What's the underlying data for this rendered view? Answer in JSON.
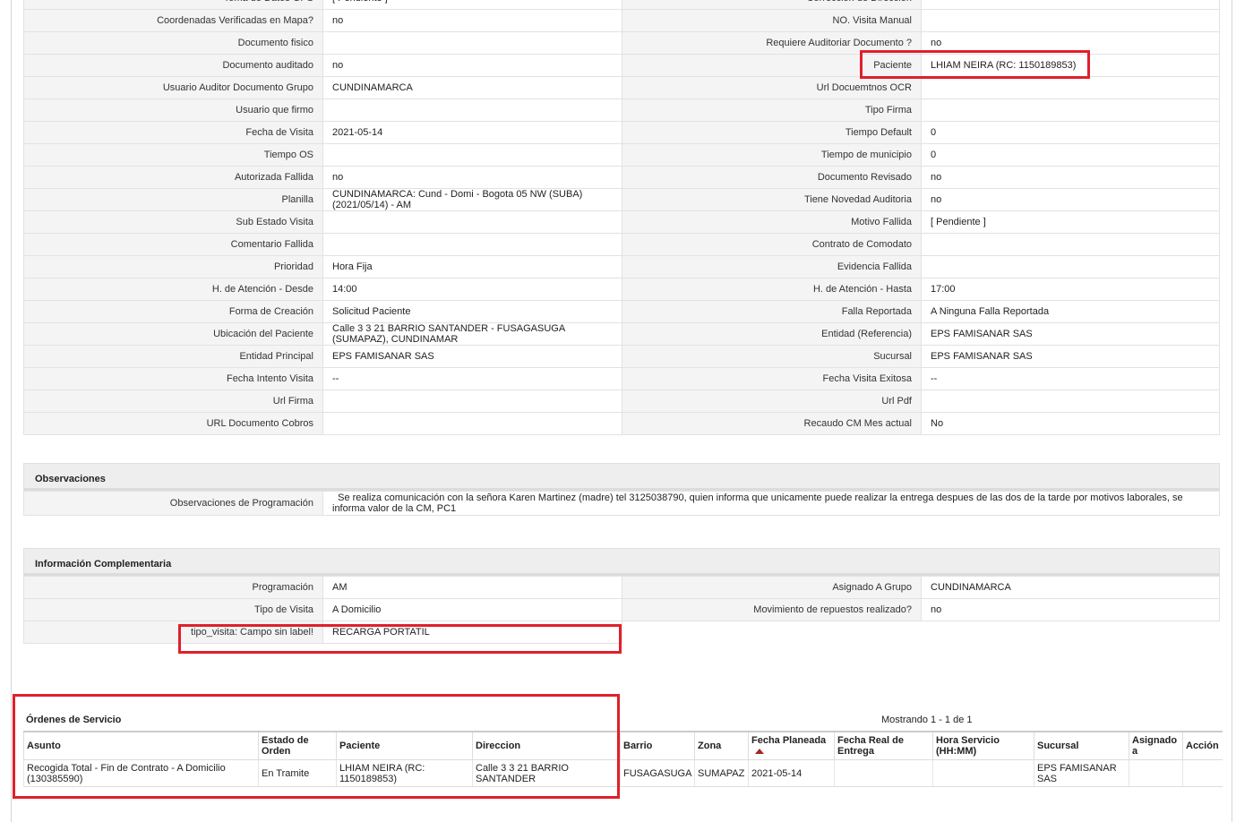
{
  "top_cut_row": {
    "left_label": "Toma de Datos GPS",
    "left_value": "[ Pendiente ]",
    "right_label": "Corrección de Dirección",
    "right_value": ""
  },
  "detail_rows": [
    {
      "l_label": "Coordenadas Verificadas en Mapa?",
      "l_value": "no",
      "r_label": "NO. Visita Manual",
      "r_value": ""
    },
    {
      "l_label": "Documento fisico",
      "l_value": "",
      "r_label": "Requiere Auditoriar Documento ?",
      "r_value": "no"
    },
    {
      "l_label": "Documento auditado",
      "l_value": "no",
      "r_label": "Paciente",
      "r_value": "LHIAM NEIRA (RC: 1150189853)"
    },
    {
      "l_label": "Usuario Auditor Documento Grupo",
      "l_value": "CUNDINAMARCA",
      "r_label": "Url Docuemtnos OCR",
      "r_value": ""
    },
    {
      "l_label": "Usuario que firmo",
      "l_value": "",
      "r_label": "Tipo Firma",
      "r_value": ""
    },
    {
      "l_label": "Fecha de Visita",
      "l_value": "2021-05-14",
      "r_label": "Tiempo Default",
      "r_value": "0"
    },
    {
      "l_label": "Tiempo OS",
      "l_value": "",
      "r_label": "Tiempo de municipio",
      "r_value": "0"
    },
    {
      "l_label": "Autorizada Fallida",
      "l_value": "no",
      "r_label": "Documento Revisado",
      "r_value": "no"
    },
    {
      "l_label": "Planilla",
      "l_value": "CUNDINAMARCA: Cund - Domi - Bogota 05 NW (SUBA) (2021/05/14) - AM",
      "r_label": "Tiene Novedad Auditoria",
      "r_value": "no"
    },
    {
      "l_label": "Sub Estado Visita",
      "l_value": "",
      "r_label": "Motivo Fallida",
      "r_value": "[ Pendiente ]"
    },
    {
      "l_label": "Comentario Fallida",
      "l_value": "",
      "r_label": "Contrato de Comodato",
      "r_value": ""
    },
    {
      "l_label": "Prioridad",
      "l_value": "Hora Fija",
      "r_label": "Evidencia Fallida",
      "r_value": ""
    },
    {
      "l_label": "H. de Atención - Desde",
      "l_value": "14:00",
      "r_label": "H. de Atención - Hasta",
      "r_value": "17:00"
    },
    {
      "l_label": "Forma de Creación",
      "l_value": "Solicitud Paciente",
      "r_label": "Falla Reportada",
      "r_value": "A Ninguna Falla Reportada"
    },
    {
      "l_label": "Ubicación del Paciente",
      "l_value": "Calle 3 3 21 BARRIO SANTANDER - FUSAGASUGA (SUMAPAZ), CUNDINAMAR",
      "r_label": "Entidad (Referencia)",
      "r_value": "EPS FAMISANAR SAS"
    },
    {
      "l_label": "Entidad Principal",
      "l_value": "EPS FAMISANAR SAS",
      "r_label": "Sucursal",
      "r_value": "EPS FAMISANAR SAS"
    },
    {
      "l_label": "Fecha Intento Visita",
      "l_value": "--",
      "r_label": "Fecha Visita Exitosa",
      "r_value": "--"
    },
    {
      "l_label": "Url Firma",
      "l_value": "",
      "r_label": "Url Pdf",
      "r_value": ""
    },
    {
      "l_label": "URL Documento Cobros",
      "l_value": "",
      "r_label": "Recaudo CM Mes actual",
      "r_value": "No"
    }
  ],
  "observaciones": {
    "title": "Observaciones",
    "label": "Observaciones de Programación",
    "value": "Se realiza comunicación con la señora Karen Martinez (madre) tel 3125038790, quien informa que unicamente puede realizar la entrega despues de las dos de la tarde por motivos laborales, se informa valor de la CM, PC1"
  },
  "info_complementaria": {
    "title": "Información Complementaria",
    "rows": [
      {
        "l_label": "Programación",
        "l_value": "AM",
        "r_label": "Asignado A Grupo",
        "r_value": "CUNDINAMARCA"
      },
      {
        "l_label": "Tipo de Visita",
        "l_value": "A Domicilio",
        "r_label": "Movimiento de repuestos realizado?",
        "r_value": "no"
      }
    ],
    "extra_label": "tipo_visita: Campo sin label!",
    "extra_value": "RECARGA PORTATIL"
  },
  "ordenes": {
    "title": "Órdenes de Servicio",
    "count_text": "Mostrando 1 - 1 de 1",
    "columns": [
      "Asunto",
      "Estado de Orden",
      "Paciente",
      "Direccion",
      "Barrio",
      "Zona",
      "Fecha Planeada",
      "Fecha Real de Entrega",
      "Hora Servicio (HH:MM)",
      "Sucursal",
      "Asignado a",
      "Acción"
    ],
    "rows": [
      {
        "asunto": "Recogida Total - Fin de Contrato - A Domicilio (130385590)",
        "estado": "En Tramite",
        "paciente": "LHIAM NEIRA (RC: 1150189853)",
        "direccion": "Calle 3 3 21 BARRIO SANTANDER",
        "barrio": "FUSAGASUGA",
        "zona": "SUMAPAZ",
        "fecha_planeada": "2021-05-14",
        "fecha_real": "",
        "hora_servicio": "",
        "sucursal": "EPS FAMISANAR SAS",
        "asignado": "",
        "accion": ""
      }
    ]
  },
  "colors": {
    "highlight": "#e0202a",
    "label_bg": "#f4f4f4",
    "sort_arrow": "#a8241e"
  }
}
